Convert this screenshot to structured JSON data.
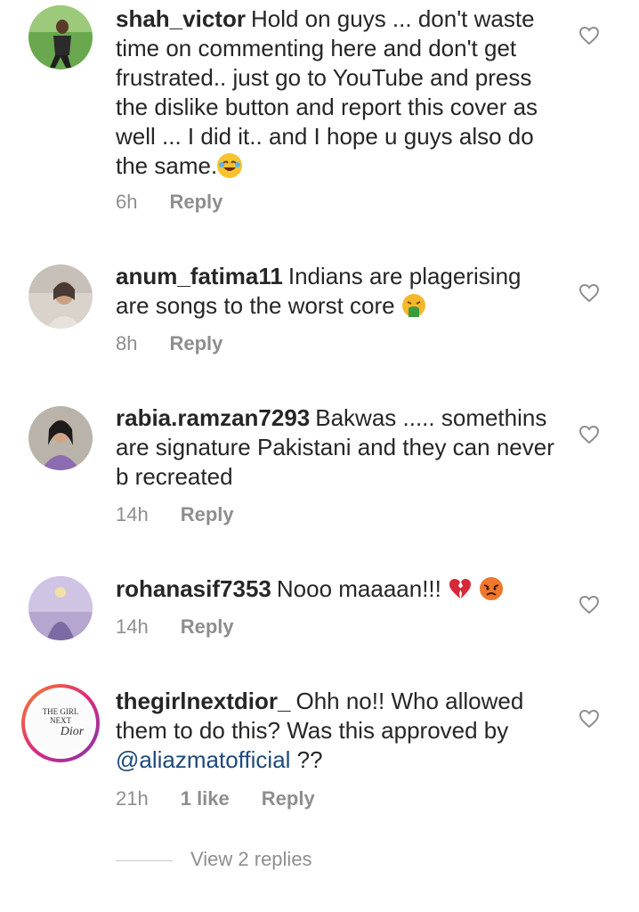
{
  "comments": [
    {
      "username": "shah_victor",
      "text": "Hold on guys ... don't waste time on commenting here and don't get frustrated.. just go to YouTube and press the dislike button and report this cover as well ... I did it.. and I hope u guys also do the same.",
      "emoji": "laughing-tears-emoji",
      "time": "6h",
      "reply_label": "Reply"
    },
    {
      "username": "anum_fatima11",
      "text": "Indians are plagerising are songs to the worst core",
      "emoji": "vomiting-face-emoji",
      "time": "8h",
      "reply_label": "Reply"
    },
    {
      "username": "rabia.ramzan7293",
      "text": "Bakwas ..... somethins are signature Pakistani and they can never b recreated",
      "time": "14h",
      "reply_label": "Reply"
    },
    {
      "username": "rohanasif7353",
      "text": "Nooo maaaan!!!",
      "emoji": "broken-heart-and-angry-face-emoji",
      "time": "14h",
      "reply_label": "Reply"
    },
    {
      "username": "thegirlnextdior_",
      "text_before": "Ohh no!! Who allowed them to do this? Was this approved by",
      "mention": "@aliazmatofficial",
      "text_after": "??",
      "time": "21h",
      "likes": "1 like",
      "reply_label": "Reply",
      "avatar_text": [
        "THE GIRL",
        "NEXT",
        "Dior"
      ]
    }
  ],
  "view_replies": "View 2 replies",
  "colors": {
    "text": "#262626",
    "meta": "#8e8e8e",
    "mention": "#1e4a7a",
    "heart_outline": "#8e8e8e"
  }
}
